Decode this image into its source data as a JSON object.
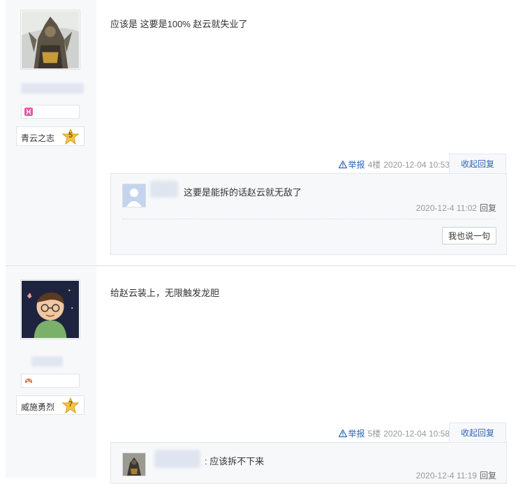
{
  "post1": {
    "level_title": "青云之志",
    "level_num": "5",
    "content": "应该是 这要是100% 赵云就失业了",
    "report_label": "举报",
    "floor": "4楼",
    "time": "2020-12-04 10:53",
    "collapse_label": "收起回复",
    "reply": {
      "text": "这要是能拆的话赵云就无敌了",
      "time": "2020-12-4 11:02",
      "reply_label": "回复"
    },
    "say_button": "我也说一句"
  },
  "post2": {
    "level_title": "威施勇烈",
    "level_num": "7",
    "content": "给赵云装上，无限触发龙胆",
    "report_label": "举报",
    "floor": "5楼",
    "time": "2020-12-04 10:58",
    "collapse_label": "收起回复",
    "reply": {
      "text": ": 应该拆不下来",
      "time": "2020-12-4 11:19",
      "reply_label": "回复"
    }
  },
  "colors": {
    "link": "#2d64b3",
    "meta": "#999999",
    "panel": "#f7f8fa"
  }
}
